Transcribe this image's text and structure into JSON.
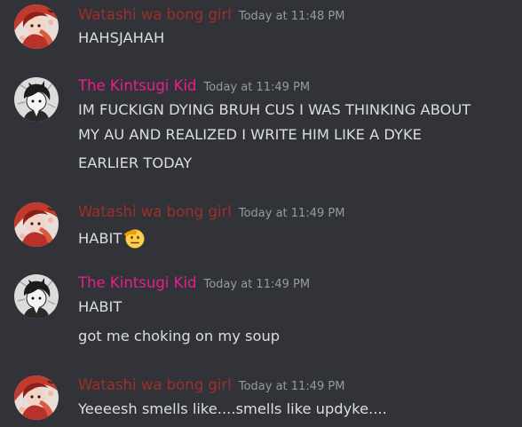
{
  "colors": {
    "background": "#313338",
    "text": "#dbdee1",
    "timestamp": "#949ba4",
    "author_watashi": "#9e2f2a",
    "author_kintsugi": "#e91e8c"
  },
  "messages": [
    {
      "author": "Watashi wa bong girl",
      "timestamp": "Today at 11:48 PM",
      "avatar_icon": "anime-girl-red-avatar",
      "lines": [
        "HAHSJAHAH"
      ]
    },
    {
      "author": "The Kintsugi Kid",
      "timestamp": "Today at 11:49 PM",
      "avatar_icon": "anime-boy-monochrome-avatar",
      "lines": [
        "IM FUCKIGN DYING BRUH CUS I WAS THINKING ABOUT",
        "MY AU AND REALIZED I WRITE HIM LIKE A DYKE",
        "EARLIER TODAY"
      ]
    },
    {
      "author": "Watashi wa bong girl",
      "timestamp": "Today at 11:49 PM",
      "avatar_icon": "anime-girl-red-avatar",
      "lines": [
        "HABIT"
      ],
      "emoji": "saluting-face-emoji"
    },
    {
      "author": "The Kintsugi Kid",
      "timestamp": "Today at 11:49 PM",
      "avatar_icon": "anime-boy-monochrome-avatar",
      "lines": [
        "HABIT",
        "got me choking on my soup"
      ]
    },
    {
      "author": "Watashi wa bong girl",
      "timestamp": "Today at 11:49 PM",
      "avatar_icon": "anime-girl-red-avatar",
      "lines": [
        "Yeeeesh smells like....smells like updyke...."
      ]
    }
  ]
}
